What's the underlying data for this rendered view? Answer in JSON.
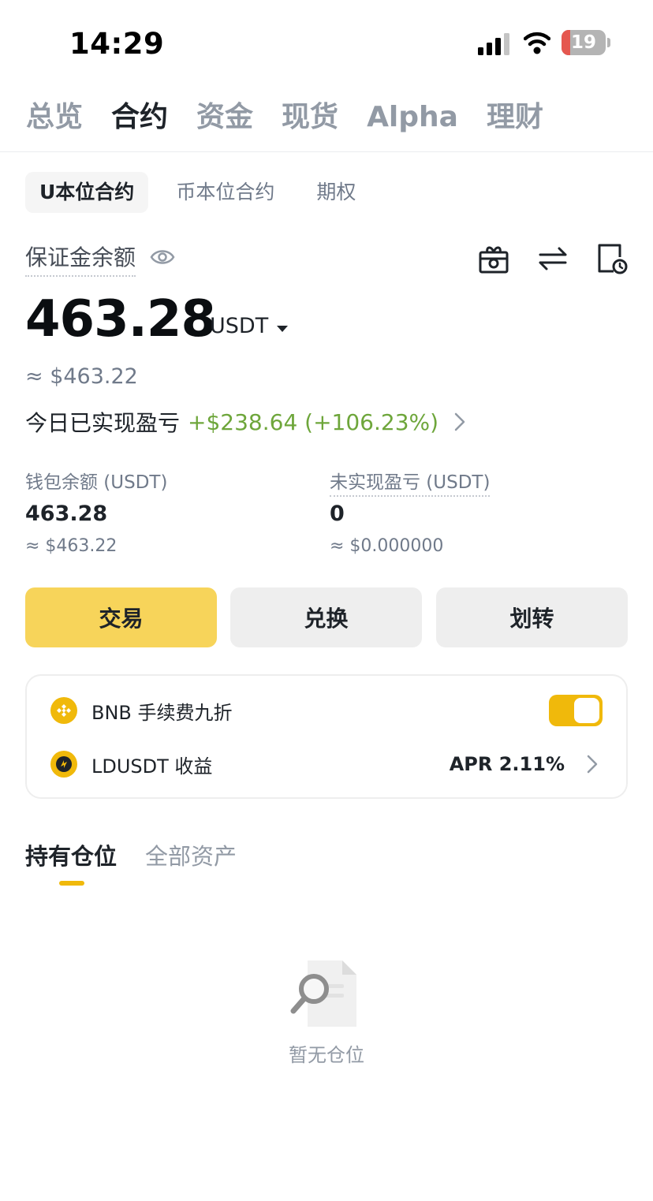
{
  "status_bar": {
    "time": "14:29",
    "battery": "19",
    "battery_level": 0.19
  },
  "top_tabs": [
    {
      "label": "总览",
      "active": false
    },
    {
      "label": "合约",
      "active": true
    },
    {
      "label": "资金",
      "active": false
    },
    {
      "label": "现货",
      "active": false
    },
    {
      "label": "Alpha",
      "active": false
    },
    {
      "label": "理财",
      "active": false
    }
  ],
  "sub_tabs": [
    {
      "label": "U本位合约",
      "active": true
    },
    {
      "label": "币本位合约",
      "active": false
    },
    {
      "label": "期权",
      "active": false
    }
  ],
  "balance": {
    "label": "保证金余额",
    "value": "463.28",
    "unit": "USDT",
    "approx": "≈ $463.22"
  },
  "today_pnl": {
    "label": "今日已实现盈亏",
    "value": "+$238.64 (+106.23%)",
    "color": "#6ea63b"
  },
  "wallet": {
    "label": "钱包余额 (USDT)",
    "value": "463.28",
    "approx": "≈ $463.22"
  },
  "unrealized": {
    "label": "未实现盈亏 (USDT)",
    "value": "0",
    "approx": "≈ $0.000000"
  },
  "actions": {
    "trade": "交易",
    "convert": "兑换",
    "transfer": "划转"
  },
  "card": {
    "bnb_label": "BNB 手续费九折",
    "bnb_toggle_on": true,
    "ldusdt_label": "LDUSDT 收益",
    "apr": "APR 2.11%"
  },
  "position_tabs": {
    "holdings": "持有仓位",
    "all_assets": "全部资产"
  },
  "empty_text": "暂无仓位",
  "colors": {
    "accent": "#f0b90b",
    "button_primary": "#f7d45a",
    "positive": "#6ea63b"
  }
}
